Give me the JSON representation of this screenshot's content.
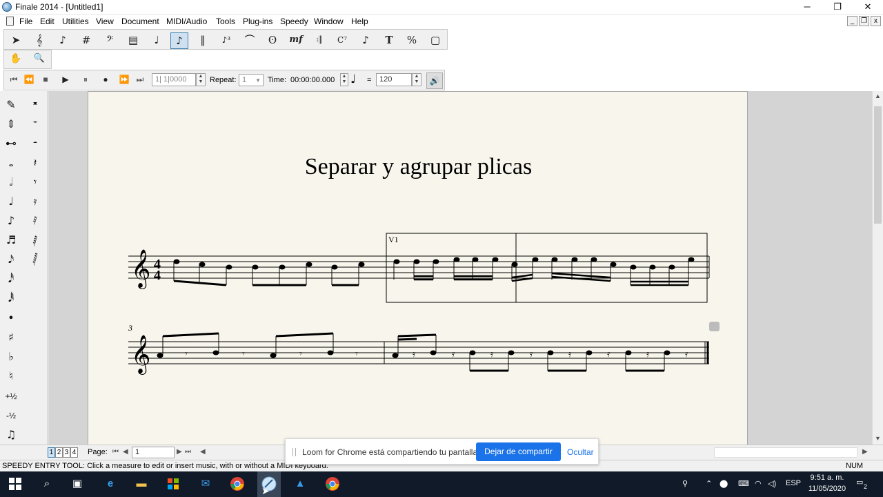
{
  "window": {
    "title": "Finale 2014 - [Untitled1]",
    "controls": [
      "─",
      "❐",
      "✕"
    ]
  },
  "menu": [
    "File",
    "Edit",
    "Utilities",
    "View",
    "Document",
    "MIDI/Audio",
    "Tools",
    "Plug-ins",
    "Speedy",
    "Window",
    "Help"
  ],
  "main_tools": [
    {
      "icon": "selection-arrow-icon",
      "glyph": "➤"
    },
    {
      "icon": "staff-tool-icon",
      "glyph": "𝄞"
    },
    {
      "icon": "simple-entry-icon",
      "glyph": "♪"
    },
    {
      "icon": "key-signature-icon",
      "glyph": "#"
    },
    {
      "icon": "clef-tool-icon",
      "glyph": "𝄢"
    },
    {
      "icon": "measure-tool-icon",
      "glyph": "▤"
    },
    {
      "icon": "note-tool-icon",
      "glyph": "♩"
    },
    {
      "icon": "speedy-entry-icon",
      "glyph": "♪"
    },
    {
      "icon": "tuplet-staff-icon",
      "glyph": "‖"
    },
    {
      "icon": "tuplet-tool-icon",
      "glyph": "♪³"
    },
    {
      "icon": "smart-shape-icon",
      "glyph": "⌒"
    },
    {
      "icon": "articulation-tool-icon",
      "glyph": "ʘ"
    },
    {
      "icon": "expression-tool-icon",
      "glyph": "mf"
    },
    {
      "icon": "repeat-tool-icon",
      "glyph": "𝄇"
    },
    {
      "icon": "chord-tool-icon",
      "glyph": "C⁷"
    },
    {
      "icon": "lyrics-tool-icon",
      "glyph": "♪"
    },
    {
      "icon": "text-tool-icon",
      "glyph": "T"
    },
    {
      "icon": "resize-tool-icon",
      "glyph": "%"
    },
    {
      "icon": "page-layout-icon",
      "glyph": "▢"
    }
  ],
  "hand_tool_glyph": "✋",
  "zoom_tool_glyph": "🔍",
  "playback": {
    "buttons": [
      "⏮",
      "⏪",
      "■",
      "▶",
      "⏸",
      "●",
      "⏩",
      "⏭"
    ],
    "position": "1| 1|0000",
    "repeat_label": "Repeat:",
    "repeat_value": "1",
    "time_label": "Time:",
    "time_value": "00:00:00.000",
    "tempo_eq": "=",
    "tempo_value": "120",
    "speaker_glyph": "🔊"
  },
  "palette": {
    "left": [
      "✎",
      "⇕",
      "⊷",
      "𝅝",
      "𝅗𝅥",
      "♩",
      "♪",
      "♬",
      "𝅘𝅥𝅯",
      "𝅘𝅥𝅰",
      "𝅘𝅥𝅱",
      "•",
      "♯",
      "♭",
      "♮",
      "+½",
      "-½",
      "♫",
      "♫"
    ],
    "right": [
      "𝄺",
      "𝄻",
      "𝄼",
      "𝄽",
      "𝄾",
      "𝄿",
      "𝅀",
      "𝅁",
      "𝅂"
    ]
  },
  "score": {
    "title": "Separar y agrupar plicas",
    "time_sig_top": "4",
    "time_sig_bottom": "4",
    "voice_label": "V1",
    "measure_number": "3"
  },
  "page_nav": {
    "pages": [
      "1",
      "2",
      "3",
      "4"
    ],
    "page_label": "Page:",
    "page_value": "1"
  },
  "status": {
    "text": "SPEEDY ENTRY TOOL: Click a measure to edit or insert music, with or without a MIDI keyboard.",
    "num": "NUM"
  },
  "loom": {
    "message": "Loom for Chrome está compartiendo tu pantalla.",
    "stop_label": "Dejar de compartir",
    "hide_label": "Ocultar"
  },
  "taskbar": {
    "apps": [
      "start-icon",
      "search-icon",
      "task-view-icon",
      "edge-icon",
      "file-explorer-icon",
      "store-icon",
      "mail-icon",
      "chrome-icon",
      "finale-icon",
      "photos-icon",
      "chrome-icon"
    ],
    "lang": "ESP",
    "time": "9:51 a. m.",
    "date": "11/05/2020",
    "notif_count": "2"
  }
}
